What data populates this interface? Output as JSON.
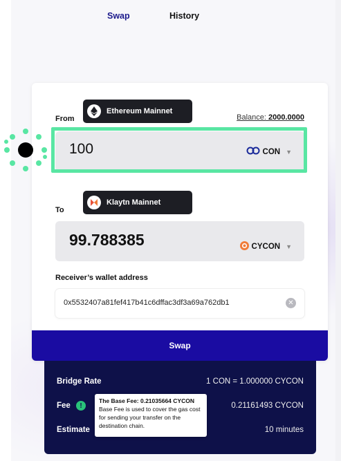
{
  "nav": {
    "swap_tab": "Swap",
    "history_tab": "History"
  },
  "from": {
    "label": "From",
    "chain": "Ethereum Mainnet",
    "chain_icon": "ethereum-icon",
    "balance_label": "Balance:",
    "balance_value": "2000.0000",
    "amount": "100",
    "token": "CON",
    "token_icon": "con-token-icon"
  },
  "to": {
    "label": "To",
    "chain": "Klaytn Mainnet",
    "chain_icon": "klaytn-icon",
    "amount": "99.788385",
    "token": "CYCON",
    "token_icon": "cycon-token-icon"
  },
  "receiver": {
    "label": "Receiver’s wallet address",
    "value": "0x5532407a81fef417b41c6dffac3df3a69a762db1"
  },
  "swap_button": "Swap",
  "info": {
    "bridge_rate_label": "Bridge Rate",
    "bridge_rate_value": "1 CON = 1.000000 CYCON",
    "fee_label": "Fee",
    "fee_value": "0.21161493 CYCON",
    "estimate_label": "Estimate",
    "estimate_value": "10 minutes"
  },
  "tooltip": {
    "title": "The Base Fee: 0.21035664 CYCON",
    "body": "Base Fee is used to cover the gas cost for sending your transfer on the destination chain."
  },
  "colors": {
    "accent": "#1a0ca2",
    "highlight": "#59e6a3",
    "info_bg": "#0e1149"
  }
}
